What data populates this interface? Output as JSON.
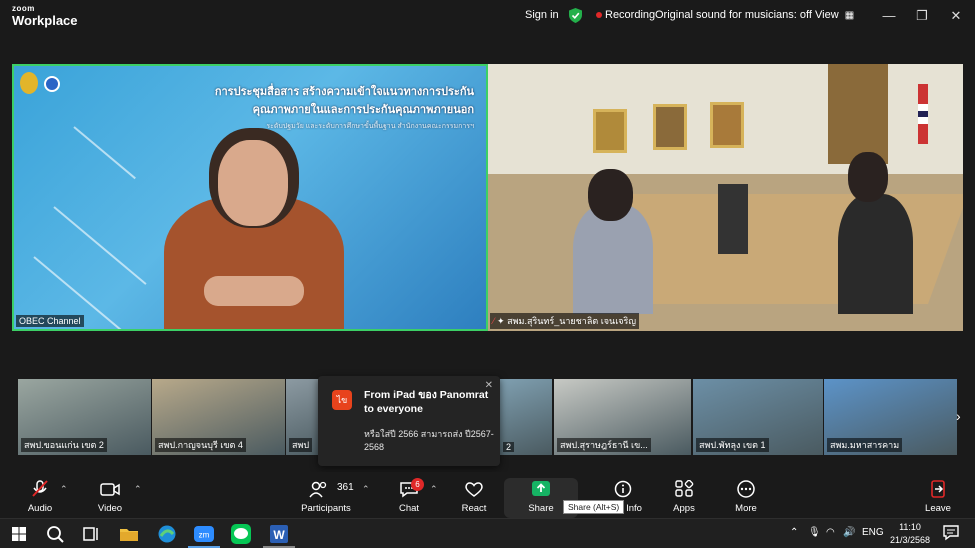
{
  "titlebar": {
    "logo_line1": "zoom",
    "logo_line2": "Workplace",
    "sign_in": "Sign in",
    "recording": "Recording",
    "original_sound": "Original sound for musicians: off",
    "view": "View"
  },
  "main_video": {
    "left": {
      "banner_line1": "การประชุมสื่อสาร สร้างความเข้าใจแนวทางการประกัน",
      "banner_line2": "คุณภาพภายในและการประกันคุณภาพภายนอก",
      "banner_line3": "ระดับปฐมวัย และระดับการศึกษาขั้นพื้นฐาน สำนักงานคณะกรรมการฯ",
      "name": "OBEC Channel"
    },
    "right": {
      "name": "สพม.สุรินทร์_นายชาลิต เจนเจริญ"
    }
  },
  "filmstrip": [
    {
      "label": "สพป.ขอนแก่น เขต 2",
      "bg": "#9aa6a0"
    },
    {
      "label": "สพป.กาญจนบุรี เขต 4",
      "bg": "#b8a98a"
    },
    {
      "label": "สพป",
      "bg": "#8c9aa2"
    },
    {
      "label": "2",
      "bg": "#7f9fb0"
    },
    {
      "label": "สพป.สุราษฎร์ธานี เข...",
      "bg": "#c7c9c4"
    },
    {
      "label": "สพป.พัทลุง เขต 1",
      "bg": "#6c8fa6"
    },
    {
      "label": "สพม.มหาสารคาม",
      "bg": "#5c93c8"
    }
  ],
  "popup": {
    "avatar": "ไข",
    "title": "From iPad ของ Panomrat to everyone",
    "body": "หรือใส่ปี 2566 สามารถส่ง ปี2567-2568"
  },
  "toolbar": {
    "audio": "Audio",
    "video": "Video",
    "participants": "Participants",
    "participants_count": "361",
    "chat": "Chat",
    "chat_badge": "6",
    "react": "React",
    "share": "Share",
    "share_tooltip": "Share (Alt+S)",
    "info": "Info",
    "apps": "Apps",
    "more": "More",
    "leave": "Leave"
  },
  "taskbar": {
    "lang": "ENG",
    "time": "11:10",
    "date": "21/3/2568"
  },
  "colors": {
    "active_speaker_border": "#3ccf66",
    "share_green": "#16b364",
    "recording_red": "#e02828",
    "leave_red": "#e02828"
  }
}
